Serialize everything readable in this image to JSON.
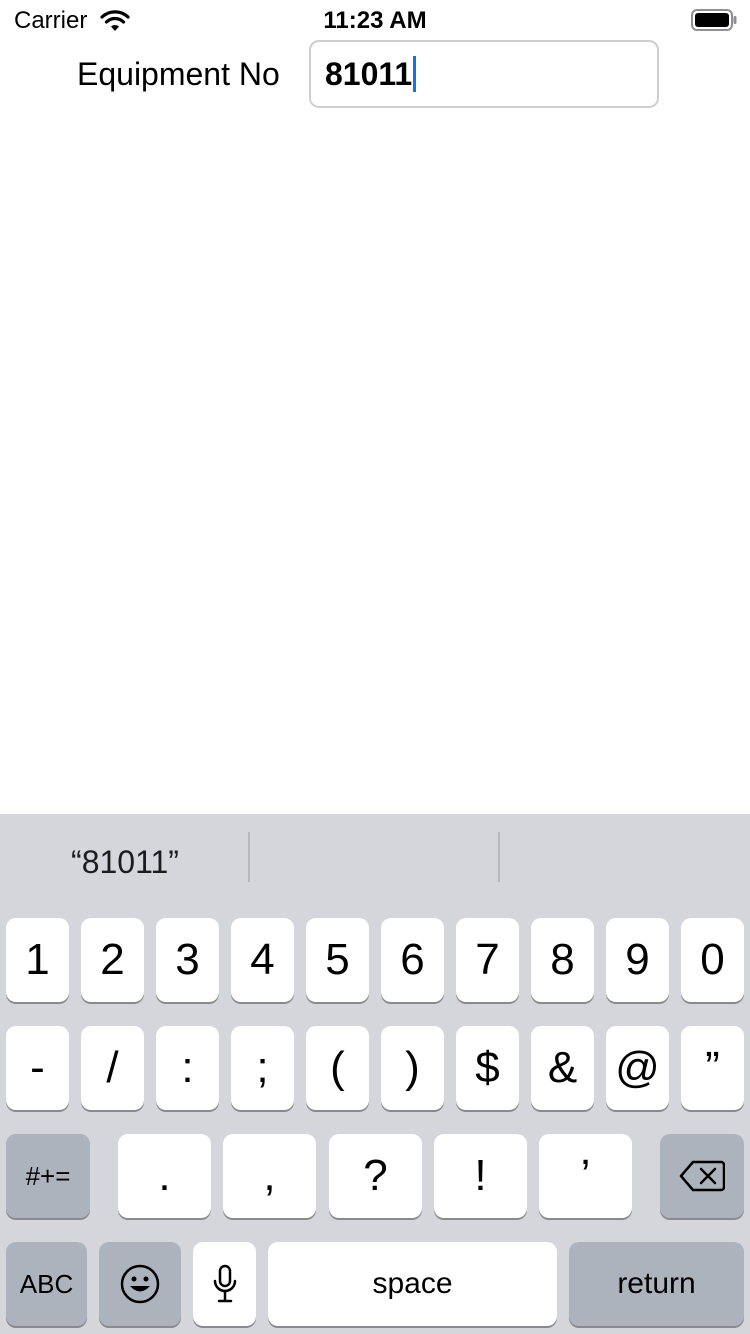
{
  "status_bar": {
    "carrier": "Carrier",
    "time": "11:23 AM",
    "wifi_icon": "wifi-icon",
    "battery_icon": "battery-icon"
  },
  "form": {
    "equipment_label": "Equipment No",
    "equipment_value": "81011"
  },
  "keyboard": {
    "suggestions": [
      "“81011”",
      "",
      ""
    ],
    "row1": [
      "1",
      "2",
      "3",
      "4",
      "5",
      "6",
      "7",
      "8",
      "9",
      "0"
    ],
    "row2": [
      "-",
      "/",
      ":",
      ";",
      "(",
      ")",
      "$",
      "&",
      "@",
      "”"
    ],
    "row3": {
      "shift_label": "#+=",
      "keys": [
        ".",
        ",",
        "?",
        "!",
        "’"
      ],
      "delete_icon": "delete-backspace-icon"
    },
    "row4": {
      "abc_label": "ABC",
      "emoji_icon": "emoji-icon",
      "mic_icon": "microphone-icon",
      "space_label": "space",
      "return_label": "return"
    }
  }
}
